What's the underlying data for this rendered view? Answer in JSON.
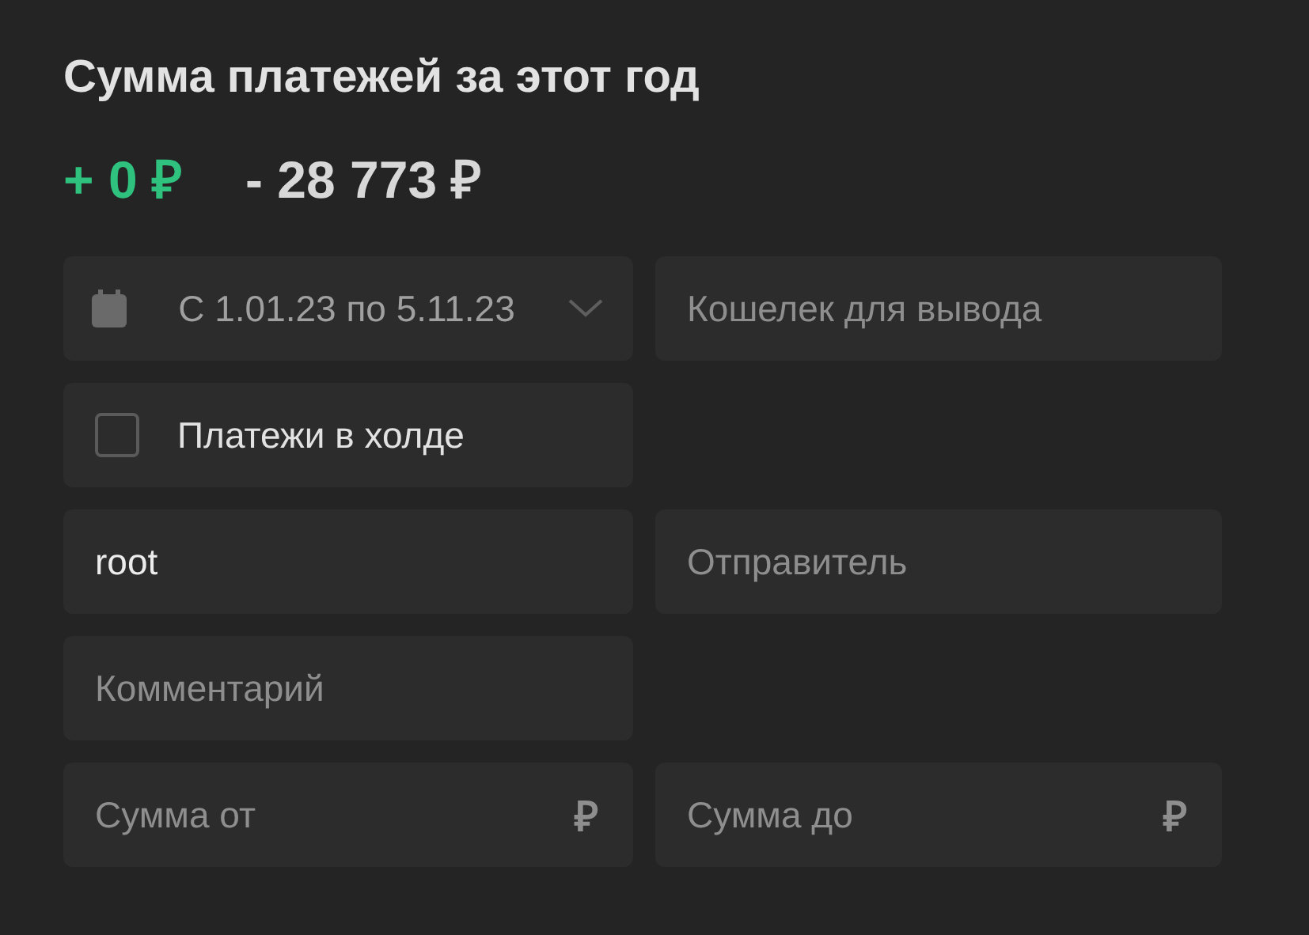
{
  "title": "Сумма платежей за этот год",
  "totals": [
    {
      "kind": "income",
      "text": "+ 0 ₽"
    },
    {
      "kind": "expense",
      "text": "- 28 773 ₽"
    }
  ],
  "rows": [
    [
      {
        "kind": "date_range",
        "value": "С 1.01.23 по 5.11.23"
      },
      {
        "kind": "text",
        "placeholder": "Кошелек для вывода"
      }
    ],
    [
      {
        "kind": "checkbox",
        "label": "Платежи в холде",
        "checked": false
      }
    ],
    [
      {
        "kind": "text",
        "value": "root"
      },
      {
        "kind": "text",
        "placeholder": "Отправитель"
      }
    ],
    [
      {
        "kind": "text",
        "placeholder": "Комментарий"
      }
    ],
    [
      {
        "kind": "amount",
        "placeholder": "Сумма от",
        "suffix": "₽"
      },
      {
        "kind": "amount",
        "placeholder": "Сумма до",
        "suffix": "₽"
      }
    ]
  ]
}
